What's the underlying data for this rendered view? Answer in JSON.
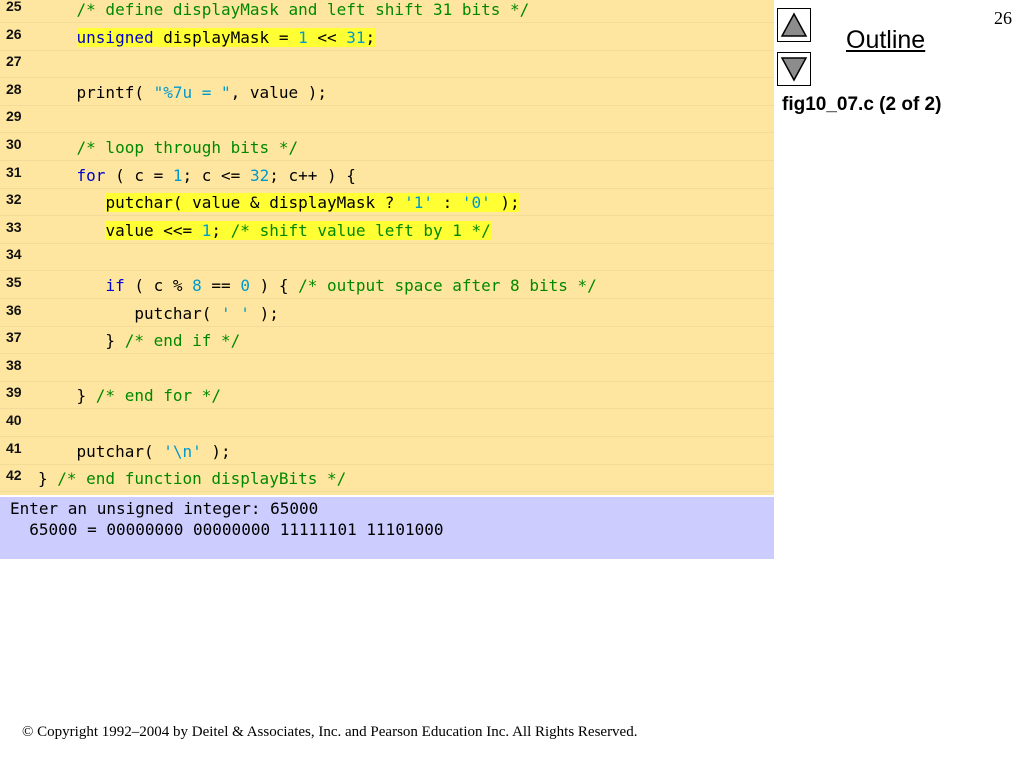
{
  "slide_number": "26",
  "outline_label": "Outline",
  "file_caption": "fig10_07.c (2 of 2)",
  "copyright": "© Copyright 1992–2004 by Deitel & Associates, Inc. and Pearson Education Inc. All Rights Reserved.",
  "colors": {
    "code_background": "#ffe6a0",
    "output_background": "#ccccff",
    "keyword": "#0000cc",
    "literal": "#0099cc",
    "comment": "#008800",
    "highlight": "#ffff33"
  },
  "icons": {
    "up": "triangle-up-icon",
    "down": "triangle-down-icon"
  },
  "code_lines": [
    {
      "num": "25",
      "tokens": [
        {
          "t": "    "
        },
        {
          "t": "/* define displayMask and left shift 31 bits */",
          "c": "com"
        }
      ]
    },
    {
      "num": "26",
      "tokens": [
        {
          "t": "    "
        },
        {
          "t": "unsigned",
          "c": "kw",
          "h": true
        },
        {
          "t": " displayMask = ",
          "h": true
        },
        {
          "t": "1",
          "c": "num",
          "h": true
        },
        {
          "t": " << ",
          "h": true
        },
        {
          "t": "31",
          "c": "num",
          "h": true
        },
        {
          "t": ";",
          "h": true
        }
      ]
    },
    {
      "num": "27",
      "tokens": []
    },
    {
      "num": "28",
      "tokens": [
        {
          "t": "    printf( "
        },
        {
          "t": "\"%7u = \"",
          "c": "str"
        },
        {
          "t": ", value );"
        }
      ]
    },
    {
      "num": "29",
      "tokens": []
    },
    {
      "num": "30",
      "tokens": [
        {
          "t": "    "
        },
        {
          "t": "/* loop through bits */",
          "c": "com"
        }
      ]
    },
    {
      "num": "31",
      "tokens": [
        {
          "t": "    "
        },
        {
          "t": "for",
          "c": "kw"
        },
        {
          "t": " ( c = "
        },
        {
          "t": "1",
          "c": "num"
        },
        {
          "t": "; c <= "
        },
        {
          "t": "32",
          "c": "num"
        },
        {
          "t": "; c++ ) {"
        }
      ]
    },
    {
      "num": "32",
      "tokens": [
        {
          "t": "       "
        },
        {
          "t": "putchar( value & displayMask ? ",
          "h": true
        },
        {
          "t": "'1'",
          "c": "str",
          "h": true
        },
        {
          "t": " : ",
          "h": true
        },
        {
          "t": "'0'",
          "c": "str",
          "h": true
        },
        {
          "t": " );",
          "h": true
        }
      ]
    },
    {
      "num": "33",
      "tokens": [
        {
          "t": "       "
        },
        {
          "t": "value <<= ",
          "h": true
        },
        {
          "t": "1",
          "c": "num",
          "h": true
        },
        {
          "t": "; ",
          "h": true
        },
        {
          "t": "/* shift value left by 1 */",
          "c": "com",
          "h": true
        }
      ]
    },
    {
      "num": "34",
      "tokens": []
    },
    {
      "num": "35",
      "tokens": [
        {
          "t": "       "
        },
        {
          "t": "if",
          "c": "kw"
        },
        {
          "t": " ( c % "
        },
        {
          "t": "8",
          "c": "num"
        },
        {
          "t": " == "
        },
        {
          "t": "0",
          "c": "num"
        },
        {
          "t": " ) { "
        },
        {
          "t": "/* output space after 8 bits */",
          "c": "com"
        }
      ]
    },
    {
      "num": "36",
      "tokens": [
        {
          "t": "          putchar( "
        },
        {
          "t": "' '",
          "c": "str"
        },
        {
          "t": " );"
        }
      ]
    },
    {
      "num": "37",
      "tokens": [
        {
          "t": "       } "
        },
        {
          "t": "/* end if */",
          "c": "com"
        }
      ]
    },
    {
      "num": "38",
      "tokens": []
    },
    {
      "num": "39",
      "tokens": [
        {
          "t": "    } "
        },
        {
          "t": "/* end for */",
          "c": "com"
        }
      ]
    },
    {
      "num": "40",
      "tokens": []
    },
    {
      "num": "41",
      "tokens": [
        {
          "t": "    putchar( "
        },
        {
          "t": "'\\n'",
          "c": "str"
        },
        {
          "t": " );"
        }
      ]
    },
    {
      "num": "42",
      "tokens": [
        {
          "t": "} "
        },
        {
          "t": "/* end function displayBits */",
          "c": "com"
        }
      ]
    }
  ],
  "output_lines": [
    "Enter an unsigned integer: 65000",
    "  65000 = 00000000 00000000 11111101 11101000"
  ]
}
